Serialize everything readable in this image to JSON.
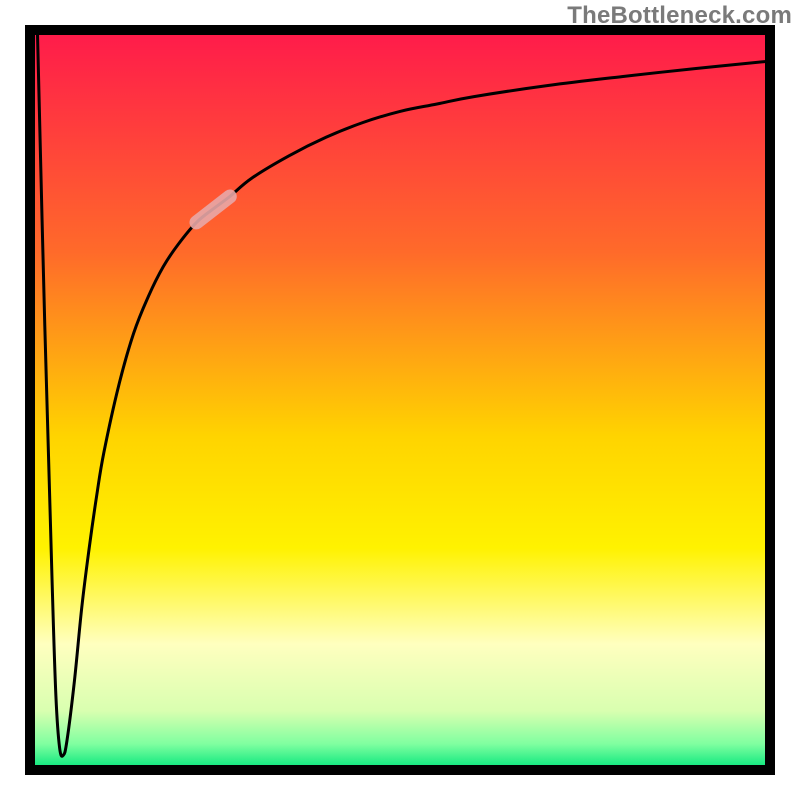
{
  "watermark": "TheBottleneck.com",
  "chart_data": {
    "type": "line",
    "title": "",
    "xlabel": "",
    "ylabel": "",
    "xlim": [
      0,
      100
    ],
    "ylim": [
      0,
      100
    ],
    "grid": false,
    "legend": false,
    "background_gradient_stops": [
      {
        "offset": 0.0,
        "color": "#ff1a4b"
      },
      {
        "offset": 0.3,
        "color": "#ff6a2a"
      },
      {
        "offset": 0.55,
        "color": "#ffd400"
      },
      {
        "offset": 0.7,
        "color": "#fff200"
      },
      {
        "offset": 0.83,
        "color": "#ffffbf"
      },
      {
        "offset": 0.92,
        "color": "#d9ffb0"
      },
      {
        "offset": 0.965,
        "color": "#7fffa0"
      },
      {
        "offset": 1.0,
        "color": "#00e57a"
      }
    ],
    "series": [
      {
        "name": "curve",
        "note": "Sharp initial drop from top-left to ~(4,2), then asymptotic rise toward ~96 at right edge. Values are % estimates read off the square plot.",
        "x": [
          1,
          2,
          3,
          3.5,
          4,
          4.5,
          5,
          6,
          7,
          8,
          9,
          10,
          12,
          14,
          16,
          18,
          20,
          22.5,
          25,
          27,
          30,
          35,
          40,
          45,
          50,
          55,
          60,
          70,
          80,
          90,
          100
        ],
        "y": [
          100,
          60,
          25,
          10,
          3,
          2,
          4,
          12,
          22,
          30,
          37,
          43,
          52,
          59,
          64,
          68,
          71,
          74,
          76,
          77.5,
          80,
          83,
          85.5,
          87.5,
          89,
          90,
          91,
          92.5,
          93.7,
          94.8,
          95.8
        ]
      },
      {
        "name": "highlight-segment",
        "note": "Short pale/thick overlay on the rising part of the curve",
        "color": "#e8a7a7",
        "width": 14,
        "x": [
          22.5,
          27
        ],
        "y": [
          74,
          77.5
        ]
      }
    ]
  }
}
